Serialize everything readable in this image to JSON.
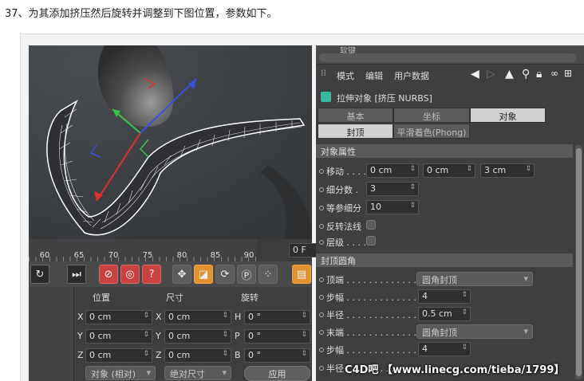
{
  "doc_title": "37、为其添加挤压然后旋转并调整到下图位置，参数如下。",
  "timeline": {
    "ticks": [
      "60",
      "65",
      "70",
      "75",
      "80",
      "85",
      "90"
    ],
    "current_frame": "0 F"
  },
  "coord_manager": {
    "headers": {
      "position": "位置",
      "size": "尺寸",
      "rotation": "旋转"
    },
    "rows": [
      {
        "axis": "X",
        "pos": "0 cm",
        "size_axis": "X",
        "size": "0 cm",
        "rot_axis": "H",
        "rot": "0 °"
      },
      {
        "axis": "Y",
        "pos": "0 cm",
        "size_axis": "Y",
        "size": "0 cm",
        "rot_axis": "P",
        "rot": "0 °"
      },
      {
        "axis": "Z",
        "pos": "0 cm",
        "size_axis": "Z",
        "size": "0 cm",
        "rot_axis": "B",
        "rot": "0 °"
      }
    ],
    "mode_dropdown": "对象 (相对)",
    "size_dropdown": "绝对尺寸",
    "apply_label": "应用"
  },
  "attr_manager": {
    "top_tab": "软键",
    "menu": {
      "mode": "模式",
      "edit": "编辑",
      "user_data": "用户数据"
    },
    "object_title": "拉伸对象 [挤压 NURBS]",
    "tabs": {
      "basic": "基本",
      "coord": "坐标",
      "object": "对象",
      "caps": "封顶",
      "phong": "平滑着色(Phong)"
    },
    "section_object": "对象属性",
    "props": {
      "move_label": "移动 . . . .",
      "move_x": "0 cm",
      "move_y": "0 cm",
      "move_z": "3 cm",
      "subdiv_label": "细分数 .",
      "subdiv_value": "3",
      "iso_label": "等参细分",
      "iso_value": "10",
      "flip_label": "反转法线",
      "hier_label": "层级 . . . ."
    },
    "section_caps": "封顶圆角",
    "caps": {
      "start_label": "顶端 . . . . . . . . . . . . .",
      "start_value": "圆角封顶",
      "steps1_label": "步幅 . . . . . . . . . . . . .",
      "steps1_value": "4",
      "radius1_label": "半径 . . . . . . . . . . . . .",
      "radius1_value": "0.5 cm",
      "end_label": "末端 . . . . . . . . . . . . .",
      "end_value": "圆角封顶",
      "steps2_label": "步幅 . . . . . . . . . . . . .",
      "steps2_value": "4",
      "radius2_label": "半径 . . . . . . . . . . . . ."
    }
  },
  "watermark": "C4D吧 【www.linecg.com/tieba/1799】",
  "colors": {
    "panel": "#3f3f3f",
    "active_tab": "#d0d0d0",
    "accent_red": "#c94141",
    "accent_orange": "#e39230"
  }
}
